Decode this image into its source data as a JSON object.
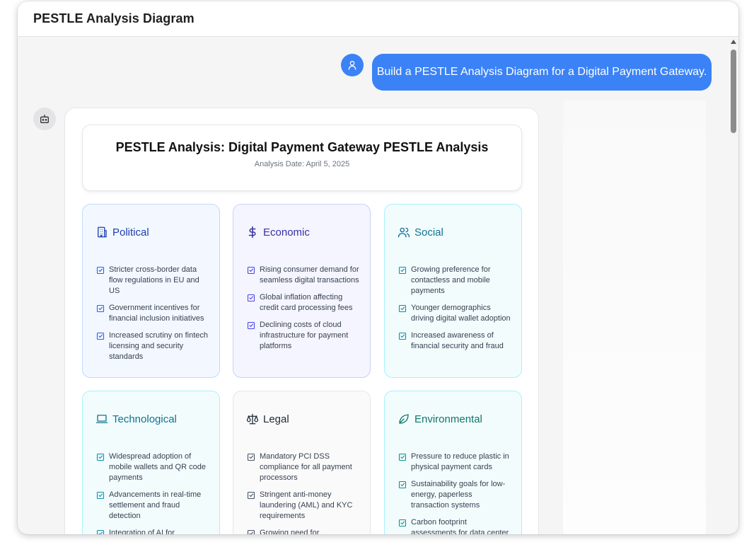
{
  "window": {
    "title": "PESTLE Analysis Diagram"
  },
  "chat": {
    "user_message": "Build a PESTLE Analysis Diagram for a Digital Payment Gateway."
  },
  "report": {
    "title": "PESTLE Analysis: Digital Payment Gateway PESTLE Analysis",
    "date": "Analysis Date: April 5, 2025"
  },
  "factors": [
    {
      "title": "Political",
      "icon": "building-icon",
      "color": "#1e40af",
      "check_color": "#2563eb",
      "items": [
        "Stricter cross-border data flow regulations in EU and US",
        "Government incentives for financial inclusion initiatives",
        "Increased scrutiny on fintech licensing and security standards"
      ]
    },
    {
      "title": "Economic",
      "icon": "dollar-icon",
      "color": "#3730a3",
      "check_color": "#4f46e5",
      "items": [
        "Rising consumer demand for seamless digital transactions",
        "Global inflation affecting credit card processing fees",
        "Declining costs of cloud infrastructure for payment platforms"
      ]
    },
    {
      "title": "Social",
      "icon": "users-icon",
      "color": "#0e7490",
      "check_color": "#0891b2",
      "items": [
        "Growing preference for contactless and mobile payments",
        "Younger demographics driving digital wallet adoption",
        "Increased awareness of financial security and fraud"
      ]
    },
    {
      "title": "Technological",
      "icon": "laptop-icon",
      "color": "#0e7490",
      "check_color": "#0891b2",
      "items": [
        "Widespread adoption of mobile wallets and QR code payments",
        "Advancements in real-time settlement and fraud detection",
        "Integration of AI for"
      ]
    },
    {
      "title": "Legal",
      "icon": "scale-icon",
      "color": "#1f2937",
      "check_color": "#4b5563",
      "items": [
        "Mandatory PCI DSS compliance for all payment processors",
        "Stringent anti-money laundering (AML) and KYC requirements",
        "Growing need for"
      ]
    },
    {
      "title": "Environmental",
      "icon": "leaf-icon",
      "color": "#0f766e",
      "check_color": "#0d9488",
      "items": [
        "Pressure to reduce plastic in physical payment cards",
        "Sustainability goals for low-energy, paperless transaction systems",
        "Carbon footprint assessments for data center operations"
      ]
    }
  ]
}
